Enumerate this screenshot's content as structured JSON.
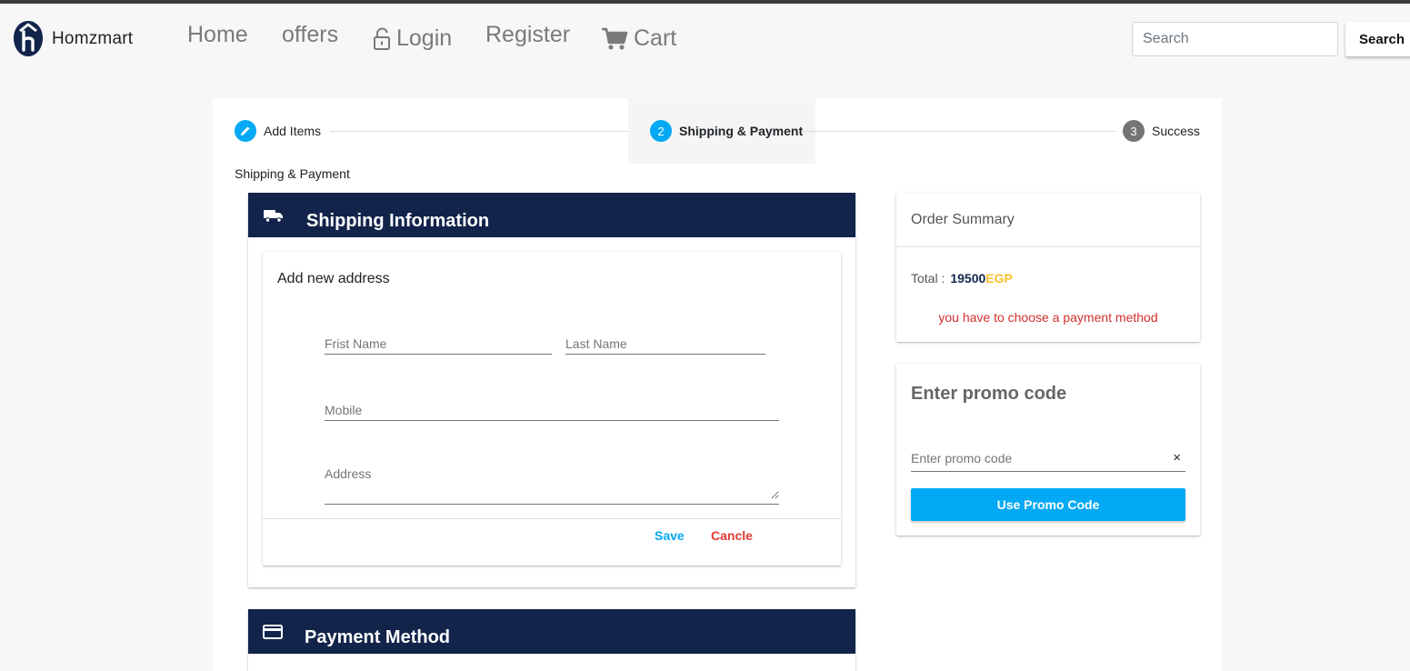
{
  "navbar": {
    "brand": "Homzmart",
    "links": {
      "home": "Home",
      "offers": "offers",
      "login": "Login",
      "register": "Register",
      "cart": "Cart"
    },
    "search_placeholder": "Search",
    "search_button": "Search"
  },
  "stepper": {
    "steps": [
      {
        "number": "",
        "label": "Add Items",
        "icon": "pencil-icon"
      },
      {
        "number": "2",
        "label": "Shipping & Payment"
      },
      {
        "number": "3",
        "label": "Success"
      }
    ]
  },
  "section_title": "Shipping & Payment",
  "shipping": {
    "title": "Shipping Information",
    "icon": "truck-icon",
    "form_title": "Add new address",
    "fields": {
      "first_name": "Frist Name",
      "last_name": "Last Name",
      "mobile": "Mobile",
      "address": "Address"
    },
    "save_label": "Save",
    "cancel_label": "Cancle"
  },
  "payment": {
    "title": "Payment Method",
    "icon": "credit-card-icon"
  },
  "summary": {
    "title": "Order Summary",
    "total_label": "Total :",
    "total_amount": "19500",
    "currency": "EGP",
    "error": "you have to choose a payment method"
  },
  "promo": {
    "title": "Enter promo code",
    "placeholder": "Enter promo code",
    "clear_icon": "×",
    "button": "Use Promo Code"
  },
  "colors": {
    "navy": "#12244a",
    "accent": "#03a9f4",
    "error": "#d32f2f",
    "currency": "#fbc02d"
  }
}
